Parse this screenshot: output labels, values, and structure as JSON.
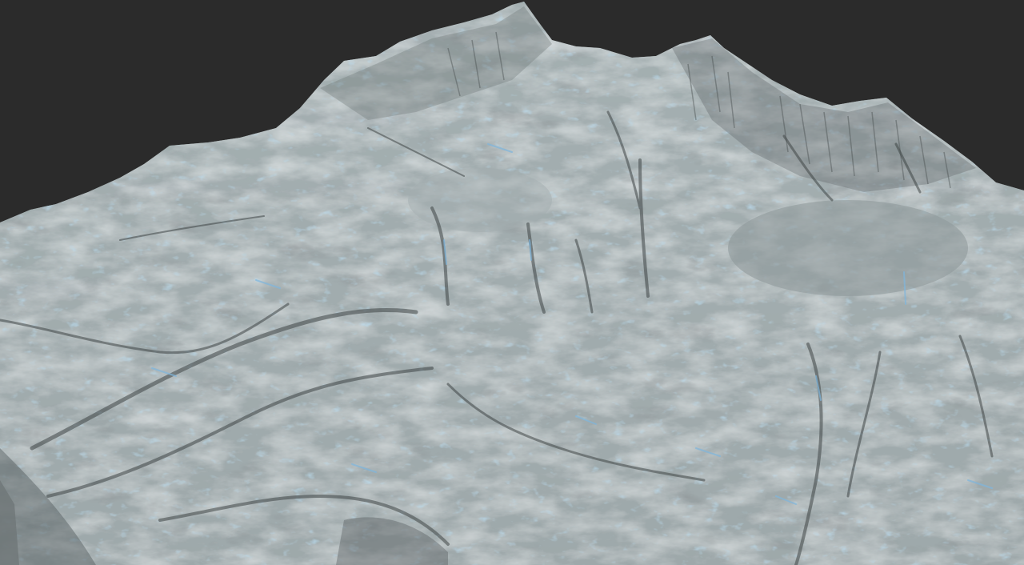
{
  "scene": {
    "kind": "3d-terrain-render",
    "background_color": "#2b2b2b",
    "terrain_base_color": "#8e9b9c",
    "terrain_light_color": "#b9c4c6",
    "terrain_shadow_color": "#4b5152",
    "highlight_color": "#7fb6dd",
    "overlays": []
  }
}
